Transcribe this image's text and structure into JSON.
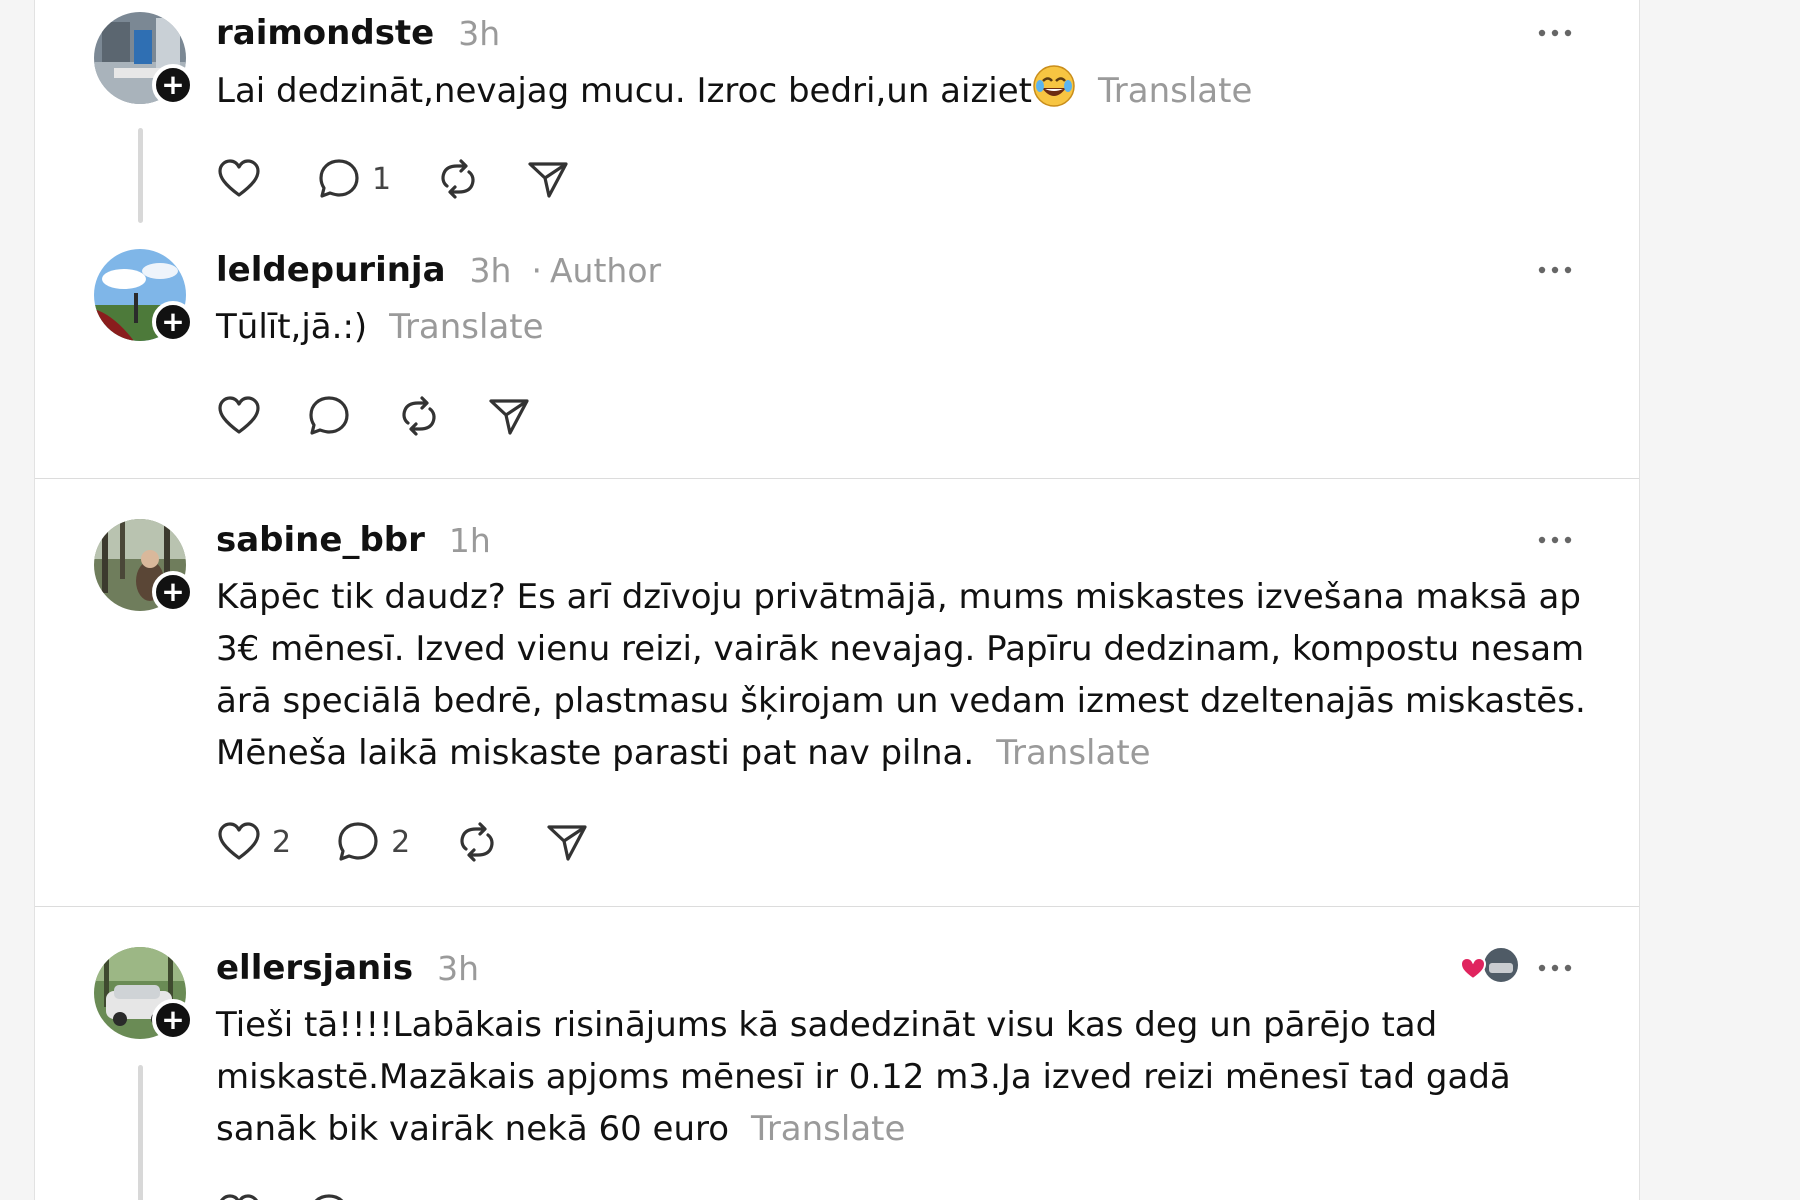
{
  "posts": [
    {
      "username": "raimondste",
      "time": "3h",
      "text": "Lai dedzināt,nevajag mucu. Izroc bedri,un aiziet",
      "emoji": "😂",
      "translate": "Translate",
      "likes": "",
      "replies": "1"
    },
    {
      "username": "leldepurinja",
      "time": "3h",
      "author_separator": "·",
      "author_label": "Author",
      "text": "Tūlīt,jā.:)",
      "translate": "Translate",
      "likes": "",
      "replies": ""
    },
    {
      "username": "sabine_bbr",
      "time": "1h",
      "text": "Kāpēc tik daudz? Es arī dzīvoju privātmājā, mums miskastes izvešana maksā ap 3€ mēnesī. Izved vienu reizi, vairāk nevajag. Papīru dedzinam, kompostu nesam ārā speciālā bedrē, plastmasu šķirojam un vedam izmest dzeltenajās miskastēs. Mēneša laikā miskaste parasti pat nav pilna.",
      "translate": "Translate",
      "likes": "2",
      "replies": "2"
    },
    {
      "username": "ellersjanis",
      "time": "3h",
      "text": "Tieši tā!!!!Labākais risinājums kā sadedzināt visu kas deg un pārējo tad miskastē.Mazākais apjoms mēnesī ir 0.12 m3.Ja izved reizi mēnesī tad gadā sanāk bik vairāk nekā 60 euro",
      "translate": "Translate",
      "likes": "",
      "replies": ""
    }
  ],
  "icons": {
    "like": "heart-icon",
    "reply": "comment-icon",
    "repost": "repost-icon",
    "share": "share-icon",
    "more": "more-icon",
    "follow": "plus-icon"
  },
  "colors": {
    "text": "#111111",
    "muted": "#9a9a9a",
    "divider": "#dcdcdc",
    "like_heart": "#e0245e"
  }
}
